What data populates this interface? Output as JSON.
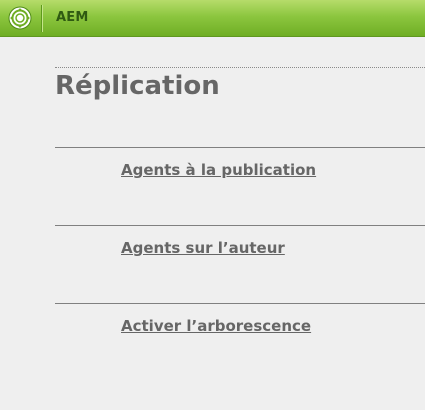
{
  "header": {
    "app_title": "AEM",
    "logo_icon": "aem-logo-icon"
  },
  "page": {
    "title": "Réplication"
  },
  "links": [
    {
      "label": "Agents à la publication"
    },
    {
      "label": "Agents sur l’auteur"
    },
    {
      "label": "Activer l’arborescence"
    }
  ],
  "colors": {
    "header_green": "#8cc63f",
    "background": "#efefef",
    "text": "#666666"
  }
}
